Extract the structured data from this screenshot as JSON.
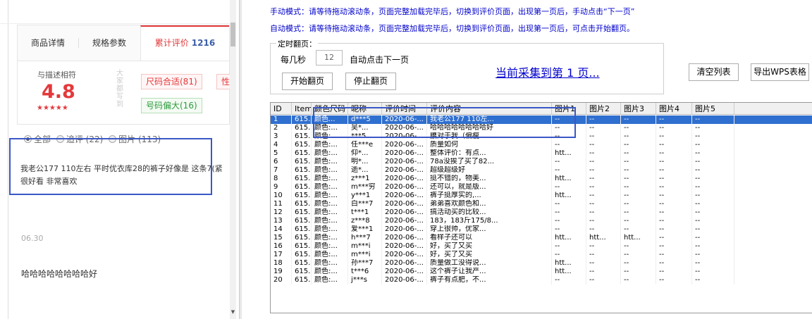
{
  "left": {
    "tabs": [
      "商品详情",
      "规格参数",
      "累计评价"
    ],
    "review_count": "1216",
    "rating": {
      "label": "与描述相符",
      "score": "4.8",
      "stars": "★★★★★",
      "side_text": "大家都写到",
      "tags": [
        "尺码合适(81)",
        "性",
        "号码偏大(16)"
      ]
    },
    "filters": [
      "全部",
      "追评 (22)",
      "图片 (113)"
    ],
    "review1": "我老公177 110左右 平时优衣库28的裤子好像是 这条7(紧 很好看 非常喜欢",
    "date": "06.30",
    "review2": "哈哈哈哈哈哈哈哈好"
  },
  "right": {
    "instruction_manual": "手动模式：请等待拖动滚动条，页面完整加载完毕后，切换到评价页面，出现第一页后，手动点击“下一页”",
    "instruction_auto": "自动模式：请等待拖动滚动条，页面完整加载完毕后，切换到评价页面，出现第一页后，可点击开始翻页。",
    "timer_group_title": "定时翻页：",
    "every_seconds_label": "每几秒",
    "seconds_value": "12",
    "auto_next_label": "自动点击下一页",
    "start_label": "开始翻页",
    "stop_label": "停止翻页",
    "progress_text": "当前采集到第 1 页...",
    "clear_label": "清空列表",
    "export_label": "导出WPS表格",
    "accent_color": "#0000cc"
  },
  "table": {
    "columns": [
      "ID",
      "ItemID",
      "颜色尺码",
      "昵称",
      "评价时间",
      "评价内容",
      "图片1",
      "图片2",
      "图片3",
      "图片4",
      "图片5"
    ],
    "rows": [
      [
        "1",
        "615...",
        "颜色...",
        "d***5",
        "2020-06-...",
        "我老公177 110左...",
        "--",
        "--",
        "--",
        "--",
        "--"
      ],
      [
        "2",
        "615...",
        "颜色:...",
        "吴*...",
        "2020-06-...",
        "哈哈哈哈哈哈哈哈好",
        "--",
        "--",
        "--",
        "--",
        "--"
      ],
      [
        "3",
        "615...",
        "颜色:...",
        "***5",
        "2020-06-...",
        "腰对于我（偏瘦...",
        "--",
        "--",
        "--",
        "--",
        "--"
      ],
      [
        "4",
        "615...",
        "颜色:...",
        "任***e",
        "2020-06-...",
        "质量如何",
        "--",
        "--",
        "--",
        "--",
        "--"
      ],
      [
        "5",
        "615...",
        "颜色:...",
        "仰*...",
        "2020-06-...",
        "整体评价：有点...",
        "htt...",
        "--",
        "--",
        "--",
        "--"
      ],
      [
        "6",
        "615...",
        "颜色:...",
        "明*...",
        "2020-06-...",
        "78a没挨了买了82...",
        "--",
        "--",
        "--",
        "--",
        "--"
      ],
      [
        "7",
        "615...",
        "颜色:...",
        "逝*...",
        "2020-06-...",
        "超级超级好",
        "--",
        "--",
        "--",
        "--",
        "--"
      ],
      [
        "8",
        "615...",
        "颜色:...",
        "z***1",
        "2020-06-...",
        "挺不错的，物美...",
        "htt...",
        "--",
        "--",
        "--",
        "--"
      ],
      [
        "9",
        "615...",
        "颜色:...",
        "m***穷",
        "2020-06-...",
        "还可以，就是版...",
        "--",
        "--",
        "--",
        "--",
        "--"
      ],
      [
        "10",
        "615...",
        "颜色:...",
        "y***1",
        "2020-06-...",
        "裤子挺厚实的,...",
        "htt...",
        "--",
        "--",
        "--",
        "--"
      ],
      [
        "11",
        "615...",
        "颜色:...",
        "白***7",
        "2020-06-...",
        "弟弟喜欢颜色和...",
        "--",
        "--",
        "--",
        "--",
        "--"
      ],
      [
        "12",
        "615...",
        "颜色:...",
        "t***1",
        "2020-06-...",
        "搞活动买的比较...",
        "--",
        "--",
        "--",
        "--",
        "--"
      ],
      [
        "13",
        "615...",
        "颜色:...",
        "z***8",
        "2020-06-...",
        "183，183斤175/8...",
        "--",
        "--",
        "--",
        "--",
        "--"
      ],
      [
        "14",
        "615...",
        "颜色:...",
        "爱***1",
        "2020-06-...",
        "穿上很帅，优家...",
        "--",
        "--",
        "--",
        "--",
        "--"
      ],
      [
        "15",
        "615...",
        "颜色:...",
        "h***7",
        "2020-06-...",
        "看样子还可以",
        "htt...",
        "htt...",
        "htt...",
        "--",
        "--"
      ],
      [
        "16",
        "615...",
        "颜色:...",
        "m***i",
        "2020-06-...",
        "好，买了又买",
        "--",
        "--",
        "--",
        "--",
        "--"
      ],
      [
        "17",
        "615...",
        "颜色:...",
        "m***i",
        "2020-06-...",
        "好，买了又买",
        "--",
        "--",
        "--",
        "--",
        "--"
      ],
      [
        "18",
        "615...",
        "颜色:...",
        "孙***7",
        "2020-06-...",
        "质量做工没得说...",
        "htt...",
        "--",
        "--",
        "--",
        "--"
      ],
      [
        "19",
        "615...",
        "颜色:...",
        "t***6",
        "2020-06-...",
        "这个裤子让我产...",
        "htt...",
        "--",
        "--",
        "--",
        "--"
      ],
      [
        "20",
        "615...",
        "颜色:...",
        "j***s",
        "2020-06-...",
        "裤子有点肥，不...",
        "--",
        "--",
        "--",
        "--",
        "--"
      ]
    ]
  }
}
